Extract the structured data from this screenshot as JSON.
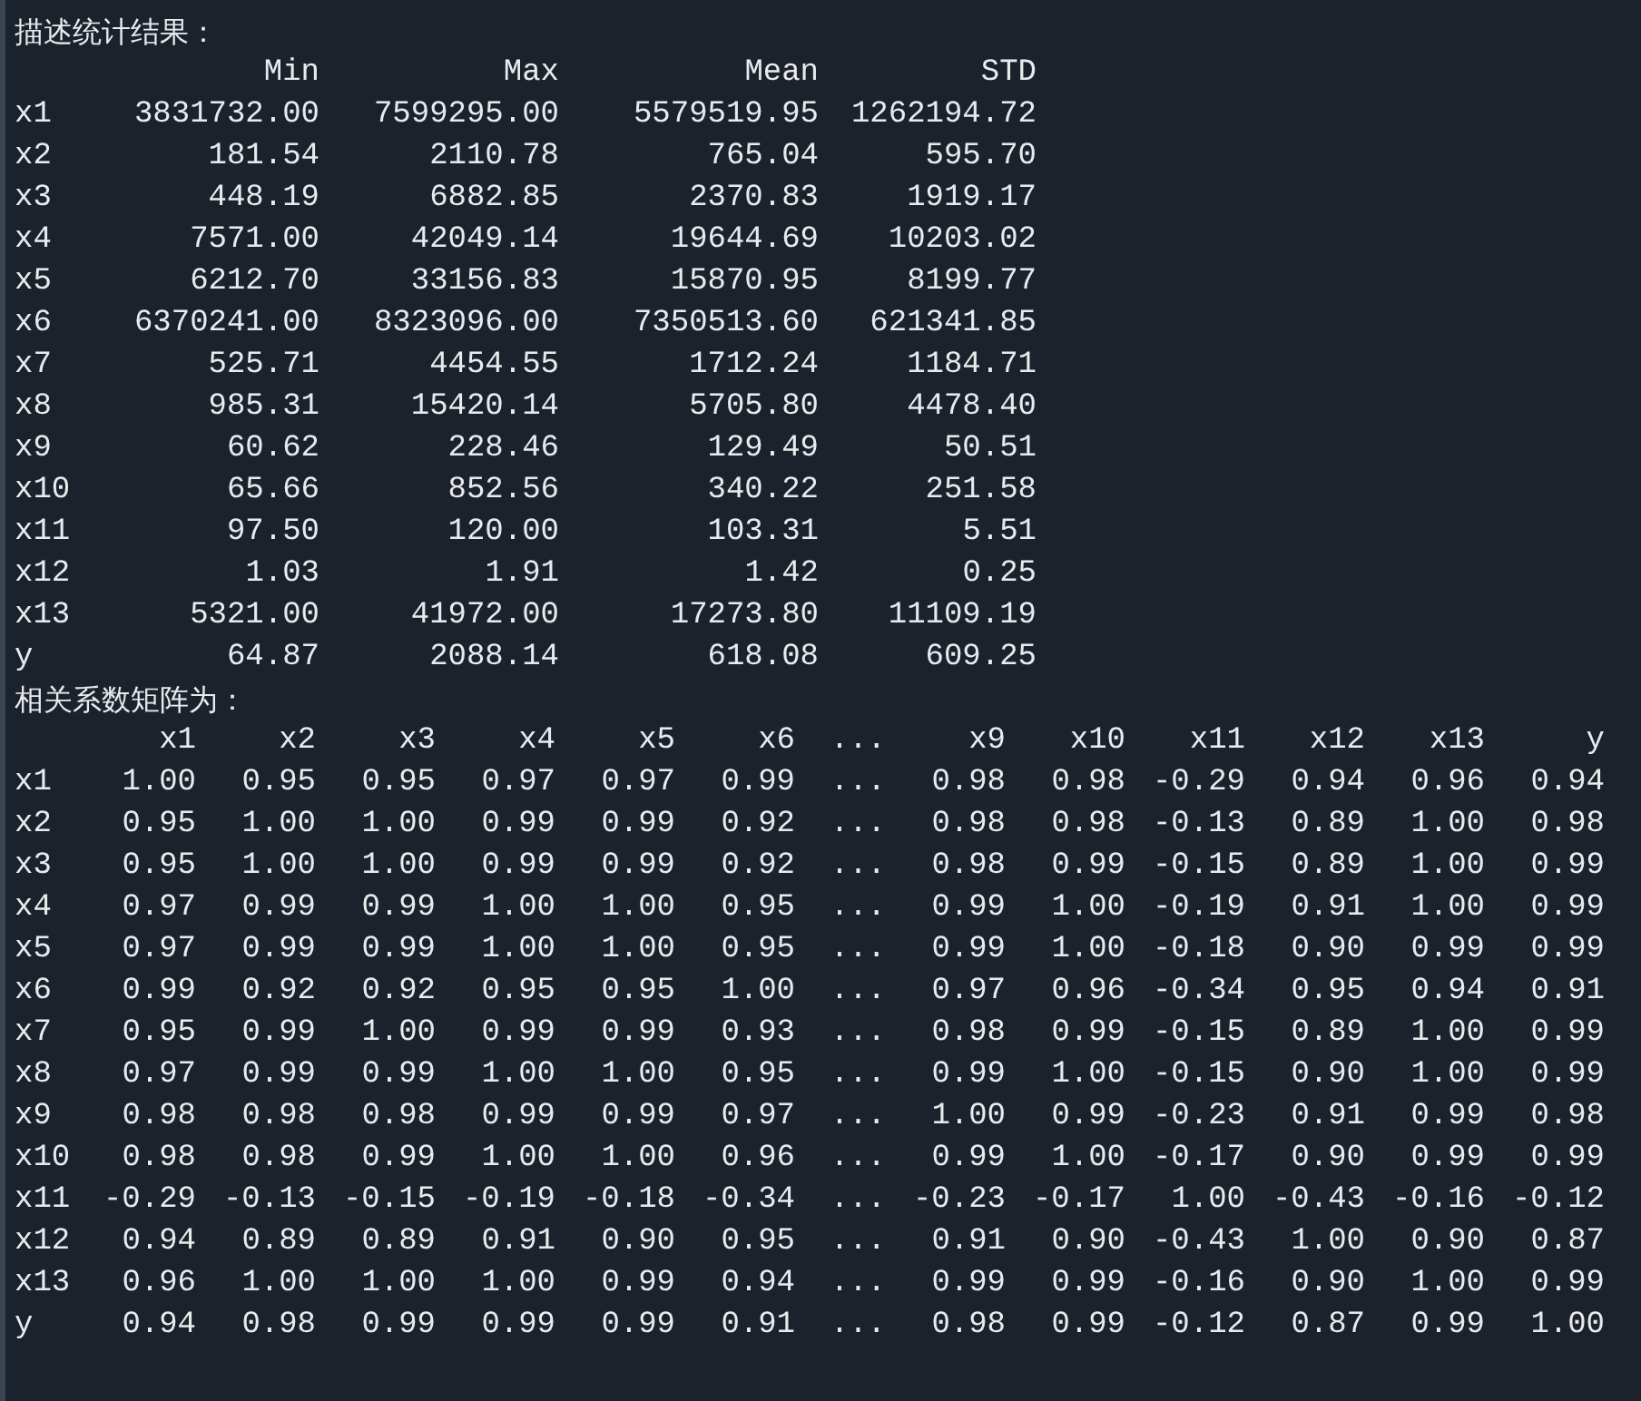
{
  "stats": {
    "title": "描述统计结果：",
    "columns": [
      "Min",
      "Max",
      "Mean",
      "STD"
    ],
    "rows": [
      {
        "label": "x1",
        "values": [
          "3831732.00",
          "7599295.00",
          "5579519.95",
          "1262194.72"
        ]
      },
      {
        "label": "x2",
        "values": [
          "181.54",
          "2110.78",
          "765.04",
          "595.70"
        ]
      },
      {
        "label": "x3",
        "values": [
          "448.19",
          "6882.85",
          "2370.83",
          "1919.17"
        ]
      },
      {
        "label": "x4",
        "values": [
          "7571.00",
          "42049.14",
          "19644.69",
          "10203.02"
        ]
      },
      {
        "label": "x5",
        "values": [
          "6212.70",
          "33156.83",
          "15870.95",
          "8199.77"
        ]
      },
      {
        "label": "x6",
        "values": [
          "6370241.00",
          "8323096.00",
          "7350513.60",
          "621341.85"
        ]
      },
      {
        "label": "x7",
        "values": [
          "525.71",
          "4454.55",
          "1712.24",
          "1184.71"
        ]
      },
      {
        "label": "x8",
        "values": [
          "985.31",
          "15420.14",
          "5705.80",
          "4478.40"
        ]
      },
      {
        "label": "x9",
        "values": [
          "60.62",
          "228.46",
          "129.49",
          "50.51"
        ]
      },
      {
        "label": "x10",
        "values": [
          "65.66",
          "852.56",
          "340.22",
          "251.58"
        ]
      },
      {
        "label": "x11",
        "values": [
          "97.50",
          "120.00",
          "103.31",
          "5.51"
        ]
      },
      {
        "label": "x12",
        "values": [
          "1.03",
          "1.91",
          "1.42",
          "0.25"
        ]
      },
      {
        "label": "x13",
        "values": [
          "5321.00",
          "41972.00",
          "17273.80",
          "11109.19"
        ]
      },
      {
        "label": "y",
        "values": [
          "64.87",
          "2088.14",
          "618.08",
          "609.25"
        ]
      }
    ]
  },
  "matrix": {
    "title": "相关系数矩阵为：",
    "columns": [
      "x1",
      "x2",
      "x3",
      "x4",
      "x5",
      "x6",
      "...",
      "x9",
      "x10",
      "x11",
      "x12",
      "x13",
      "y"
    ],
    "rows": [
      {
        "label": "x1",
        "values": [
          "1.00",
          "0.95",
          "0.95",
          "0.97",
          "0.97",
          "0.99",
          "...",
          "0.98",
          "0.98",
          "-0.29",
          "0.94",
          "0.96",
          "0.94"
        ]
      },
      {
        "label": "x2",
        "values": [
          "0.95",
          "1.00",
          "1.00",
          "0.99",
          "0.99",
          "0.92",
          "...",
          "0.98",
          "0.98",
          "-0.13",
          "0.89",
          "1.00",
          "0.98"
        ]
      },
      {
        "label": "x3",
        "values": [
          "0.95",
          "1.00",
          "1.00",
          "0.99",
          "0.99",
          "0.92",
          "...",
          "0.98",
          "0.99",
          "-0.15",
          "0.89",
          "1.00",
          "0.99"
        ]
      },
      {
        "label": "x4",
        "values": [
          "0.97",
          "0.99",
          "0.99",
          "1.00",
          "1.00",
          "0.95",
          "...",
          "0.99",
          "1.00",
          "-0.19",
          "0.91",
          "1.00",
          "0.99"
        ]
      },
      {
        "label": "x5",
        "values": [
          "0.97",
          "0.99",
          "0.99",
          "1.00",
          "1.00",
          "0.95",
          "...",
          "0.99",
          "1.00",
          "-0.18",
          "0.90",
          "0.99",
          "0.99"
        ]
      },
      {
        "label": "x6",
        "values": [
          "0.99",
          "0.92",
          "0.92",
          "0.95",
          "0.95",
          "1.00",
          "...",
          "0.97",
          "0.96",
          "-0.34",
          "0.95",
          "0.94",
          "0.91"
        ]
      },
      {
        "label": "x7",
        "values": [
          "0.95",
          "0.99",
          "1.00",
          "0.99",
          "0.99",
          "0.93",
          "...",
          "0.98",
          "0.99",
          "-0.15",
          "0.89",
          "1.00",
          "0.99"
        ]
      },
      {
        "label": "x8",
        "values": [
          "0.97",
          "0.99",
          "0.99",
          "1.00",
          "1.00",
          "0.95",
          "...",
          "0.99",
          "1.00",
          "-0.15",
          "0.90",
          "1.00",
          "0.99"
        ]
      },
      {
        "label": "x9",
        "values": [
          "0.98",
          "0.98",
          "0.98",
          "0.99",
          "0.99",
          "0.97",
          "...",
          "1.00",
          "0.99",
          "-0.23",
          "0.91",
          "0.99",
          "0.98"
        ]
      },
      {
        "label": "x10",
        "values": [
          "0.98",
          "0.98",
          "0.99",
          "1.00",
          "1.00",
          "0.96",
          "...",
          "0.99",
          "1.00",
          "-0.17",
          "0.90",
          "0.99",
          "0.99"
        ]
      },
      {
        "label": "x11",
        "values": [
          "-0.29",
          "-0.13",
          "-0.15",
          "-0.19",
          "-0.18",
          "-0.34",
          "...",
          "-0.23",
          "-0.17",
          "1.00",
          "-0.43",
          "-0.16",
          "-0.12"
        ]
      },
      {
        "label": "x12",
        "values": [
          "0.94",
          "0.89",
          "0.89",
          "0.91",
          "0.90",
          "0.95",
          "...",
          "0.91",
          "0.90",
          "-0.43",
          "1.00",
          "0.90",
          "0.87"
        ]
      },
      {
        "label": "x13",
        "values": [
          "0.96",
          "1.00",
          "1.00",
          "1.00",
          "0.99",
          "0.94",
          "...",
          "0.99",
          "0.99",
          "-0.16",
          "0.90",
          "1.00",
          "0.99"
        ]
      },
      {
        "label": "y",
        "values": [
          "0.94",
          "0.98",
          "0.99",
          "0.99",
          "0.99",
          "0.91",
          "...",
          "0.98",
          "0.99",
          "-0.12",
          "0.87",
          "0.99",
          "1.00"
        ]
      }
    ]
  }
}
